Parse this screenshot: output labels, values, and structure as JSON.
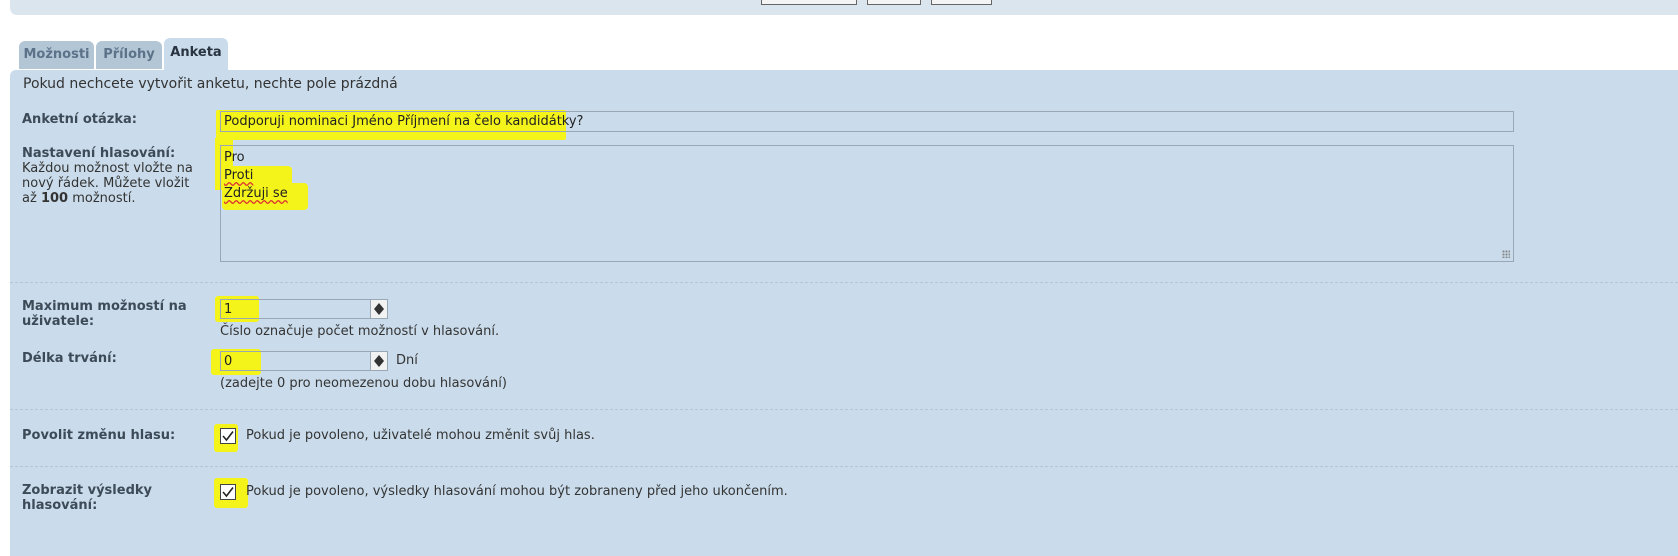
{
  "tabs": [
    {
      "label": "Možnosti"
    },
    {
      "label": "Přílohy"
    },
    {
      "label": "Anketa"
    }
  ],
  "intro_text": "Pokud nechcete vytvořit anketu, nechte pole prázdná",
  "question": {
    "label": "Anketní otázka:",
    "value": "Podporuji nominaci Jméno Příjmení na čelo kandidátky?"
  },
  "options": {
    "label": "Nastavení hlasování:",
    "help_prefix": "Každou možnost vložte na nový řádek. Můžete vložit až",
    "help_max": "100",
    "help_suffix": "možností.",
    "lines": [
      "Pro",
      "Proti",
      "Zdržuji se"
    ]
  },
  "max_options": {
    "label": "Maximum možností na uživatele:",
    "value": "1",
    "help": "Číslo označuje počet možností v hlasování."
  },
  "duration": {
    "label": "Délka trvání:",
    "value": "0",
    "unit": "Dní",
    "help": "(zadejte 0 pro neomezenou dobu hlasování)"
  },
  "allow_change": {
    "label": "Povolit změnu hlasu:",
    "checked": true,
    "help": "Pokud je povoleno, uživatelé mohou změnit svůj hlas."
  },
  "show_results": {
    "label": "Zobrazit výsledky hlasování:",
    "checked": true,
    "help": "Pokud je povoleno, výsledky hlasování mohou být zobraneny před jeho ukončením."
  },
  "colors": {
    "panel": "#cadceb",
    "tab_inactive": "#b3c6d6",
    "highlight": "#f4f41a"
  }
}
